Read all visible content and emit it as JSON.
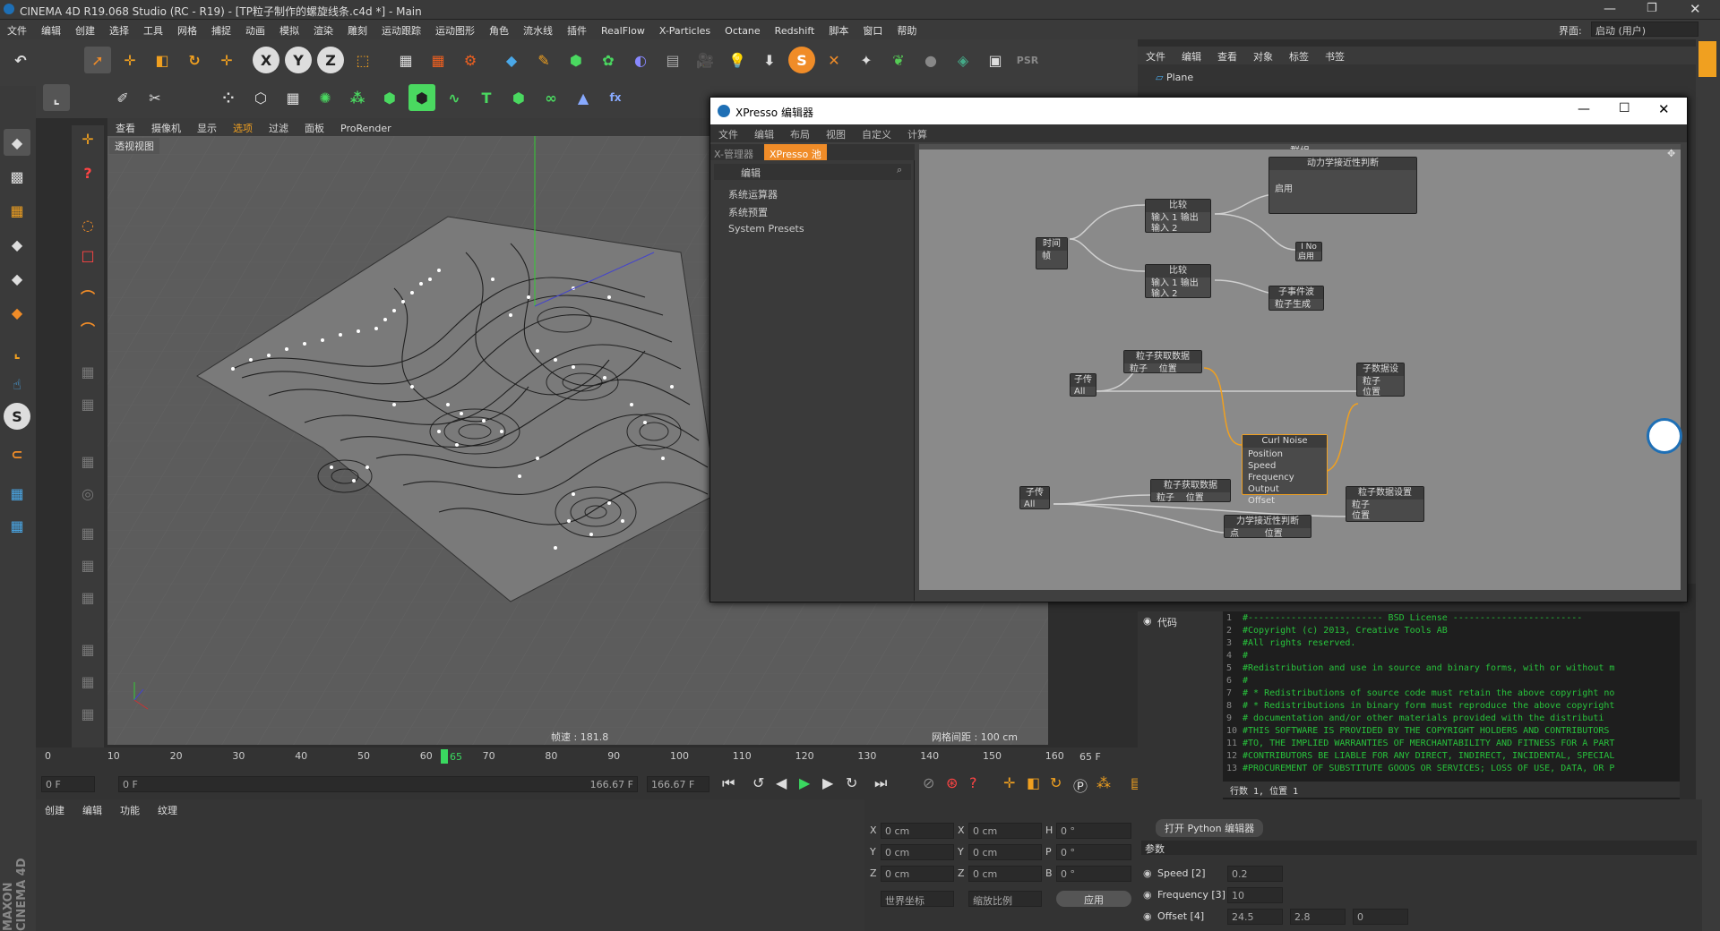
{
  "window": {
    "title": "CINEMA 4D R19.068 Studio (RC - R19) - [TP粒子制作的螺旋线条.c4d *] - Main",
    "interface_label": "界面:",
    "interface_value": "启动 (用户)"
  },
  "menu": [
    "文件",
    "编辑",
    "创建",
    "选择",
    "工具",
    "网格",
    "捕捉",
    "动画",
    "模拟",
    "渲染",
    "雕刻",
    "运动跟踪",
    "运动图形",
    "角色",
    "流水线",
    "插件",
    "RealFlow",
    "X-Particles",
    "Octane",
    "Redshift",
    "脚本",
    "窗口",
    "帮助"
  ],
  "viewport": {
    "menu": [
      "查看",
      "摄像机",
      "显示",
      "选项",
      "过滤",
      "面板",
      "ProRender"
    ],
    "label": "透视视图",
    "fps": "帧速 : 181.8",
    "grid": "网格间距 : 100 cm"
  },
  "timeline": {
    "ticks": [
      "0",
      "10",
      "20",
      "30",
      "40",
      "50",
      "60",
      "70",
      "80",
      "90",
      "100",
      "110",
      "120",
      "130",
      "140",
      "150",
      "160"
    ],
    "current": "65",
    "end": "65 F",
    "start_field": "0 F",
    "range_start": "0 F",
    "range_end": "166.67 F",
    "range_end2": "166.67 F"
  },
  "object_manager": {
    "menu": [
      "文件",
      "编辑",
      "查看",
      "对象",
      "标签",
      "书签"
    ],
    "item": "Plane"
  },
  "xpresso": {
    "title": "XPresso 编辑器",
    "menu": [
      "文件",
      "编辑",
      "布局",
      "视图",
      "自定义",
      "计算"
    ],
    "tabs": [
      "X-管理器",
      "XPresso 池"
    ],
    "pool_header": "编辑",
    "pool_items": [
      "系统运算器",
      "系统预置",
      "System Presets"
    ],
    "group": "群组",
    "nodes": {
      "compare1": {
        "title": "比较",
        "ports": [
          "输入 1",
          "输入 2"
        ],
        "out": "输出"
      },
      "compare2": {
        "title": "比较",
        "ports": [
          "输入 1",
          "输入 2"
        ],
        "out": "输出"
      },
      "time": {
        "title": "时间",
        "port": "帧"
      },
      "dyn": {
        "title": "动力学接近性判断",
        "port": "启用"
      },
      "ino": {
        "title": "I No",
        "port": "启用"
      },
      "gen": {
        "title": "子事件波",
        "port": "粒子生成"
      },
      "pget1": {
        "title": "粒子获取数据",
        "ports": "粒子    位置"
      },
      "pass1": {
        "title": "子传",
        "port": "All"
      },
      "pset1": {
        "title": "子数据设",
        "ports": [
          "粒子",
          "位置"
        ]
      },
      "curl": {
        "title": "Curl Noise",
        "ports": [
          "Position",
          "Speed",
          "Frequency",
          "Offset"
        ],
        "out": "Output"
      },
      "pass2": {
        "title": "子传",
        "port": "All"
      },
      "pget2": {
        "title": "粒子获取数据",
        "ports": "粒子    位置"
      },
      "pset2": {
        "title": "粒子数据设置",
        "ports": [
          "粒子",
          "位置"
        ]
      },
      "prox": {
        "title": "力学接近性判断",
        "ports": "点         位置"
      }
    }
  },
  "code": {
    "label": "代码",
    "status": "行数 1, 位置 1",
    "lines": [
      "#------------------------- BSD License  ------------------------",
      "#Copyright (c) 2013, Creative Tools AB",
      "#All rights reserved.",
      "#",
      "#Redistribution and use in source and binary forms, with or without m",
      "#",
      "# * Redistributions of source code must retain the above copyright no",
      "# * Redistributions in binary form must reproduce the above copyright",
      "#   documentation and/or other materials provided with the distributi",
      "#THIS SOFTWARE IS PROVIDED BY THE COPYRIGHT HOLDERS AND CONTRIBUTORS",
      "#TO, THE IMPLIED WARRANTIES OF MERCHANTABILITY AND FITNESS FOR A PART",
      "#CONTRIBUTORS BE LIABLE FOR ANY DIRECT, INDIRECT, INCIDENTAL, SPECIAL",
      "#PROCUREMENT OF SUBSTITUTE GOODS OR SERVICES; LOSS OF USE, DATA, OR P"
    ]
  },
  "python_button": "打开 Python 编辑器",
  "params": {
    "header": "参数",
    "speed_label": "Speed [2]",
    "speed": "0.2",
    "freq_label": "Frequency [3]",
    "freq": "10",
    "offset_label": "Offset [4]",
    "offset": [
      "24.5",
      "2.8",
      "0"
    ]
  },
  "material": {
    "menu": [
      "创建",
      "编辑",
      "功能",
      "纹理"
    ]
  },
  "coords": {
    "x": "0 cm",
    "y": "0 cm",
    "z": "0 cm",
    "h": "0 °",
    "p": "0 °",
    "b": "0 °",
    "world": "世界坐标",
    "scale": "缩放比例",
    "apply": "应用"
  },
  "brand": "MAXON CINEMA 4D"
}
